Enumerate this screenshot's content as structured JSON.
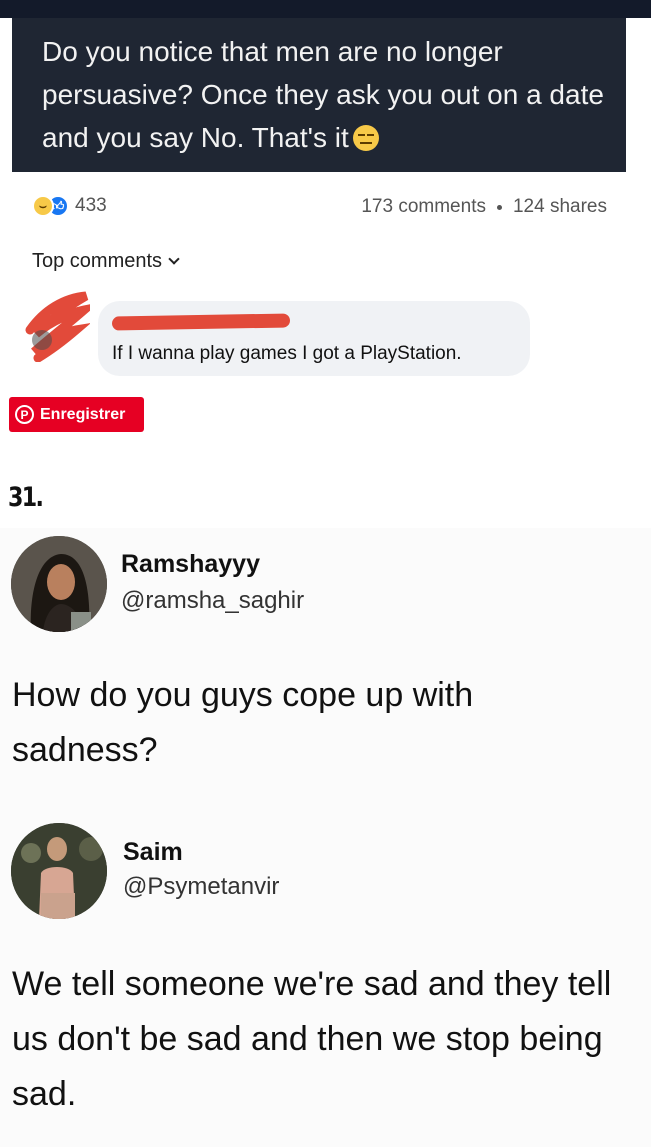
{
  "post": {
    "text": "Do you notice that men are no longer persuasive? Once they ask you out on a date and you say No. That's it",
    "emoji": "expressionless-face-emoji"
  },
  "reactions": {
    "count": "433",
    "icons": [
      "haha-reaction-icon",
      "like-reaction-icon"
    ],
    "comments": "173 comments",
    "shares": "124 shares"
  },
  "top_comments_label": "Top comments",
  "comment": {
    "text": "If I wanna play games I got a PlayStation."
  },
  "pinterest": {
    "label": "Enregistrer",
    "color": "#e60023"
  },
  "item_number": "31.",
  "tweets": [
    {
      "name": "Ramshayyy",
      "handle": "@ramsha_saghir",
      "text": "How do you guys cope up with sadness?"
    },
    {
      "name": "Saim",
      "handle": "@Psymetanvir",
      "text": "We tell someone we're sad and they tell us don't be sad and then we stop being sad."
    }
  ],
  "colors": {
    "dark_post_bg": "#1f2633",
    "facebook_blue": "#1877f2",
    "redaction": "#e24a3a"
  }
}
